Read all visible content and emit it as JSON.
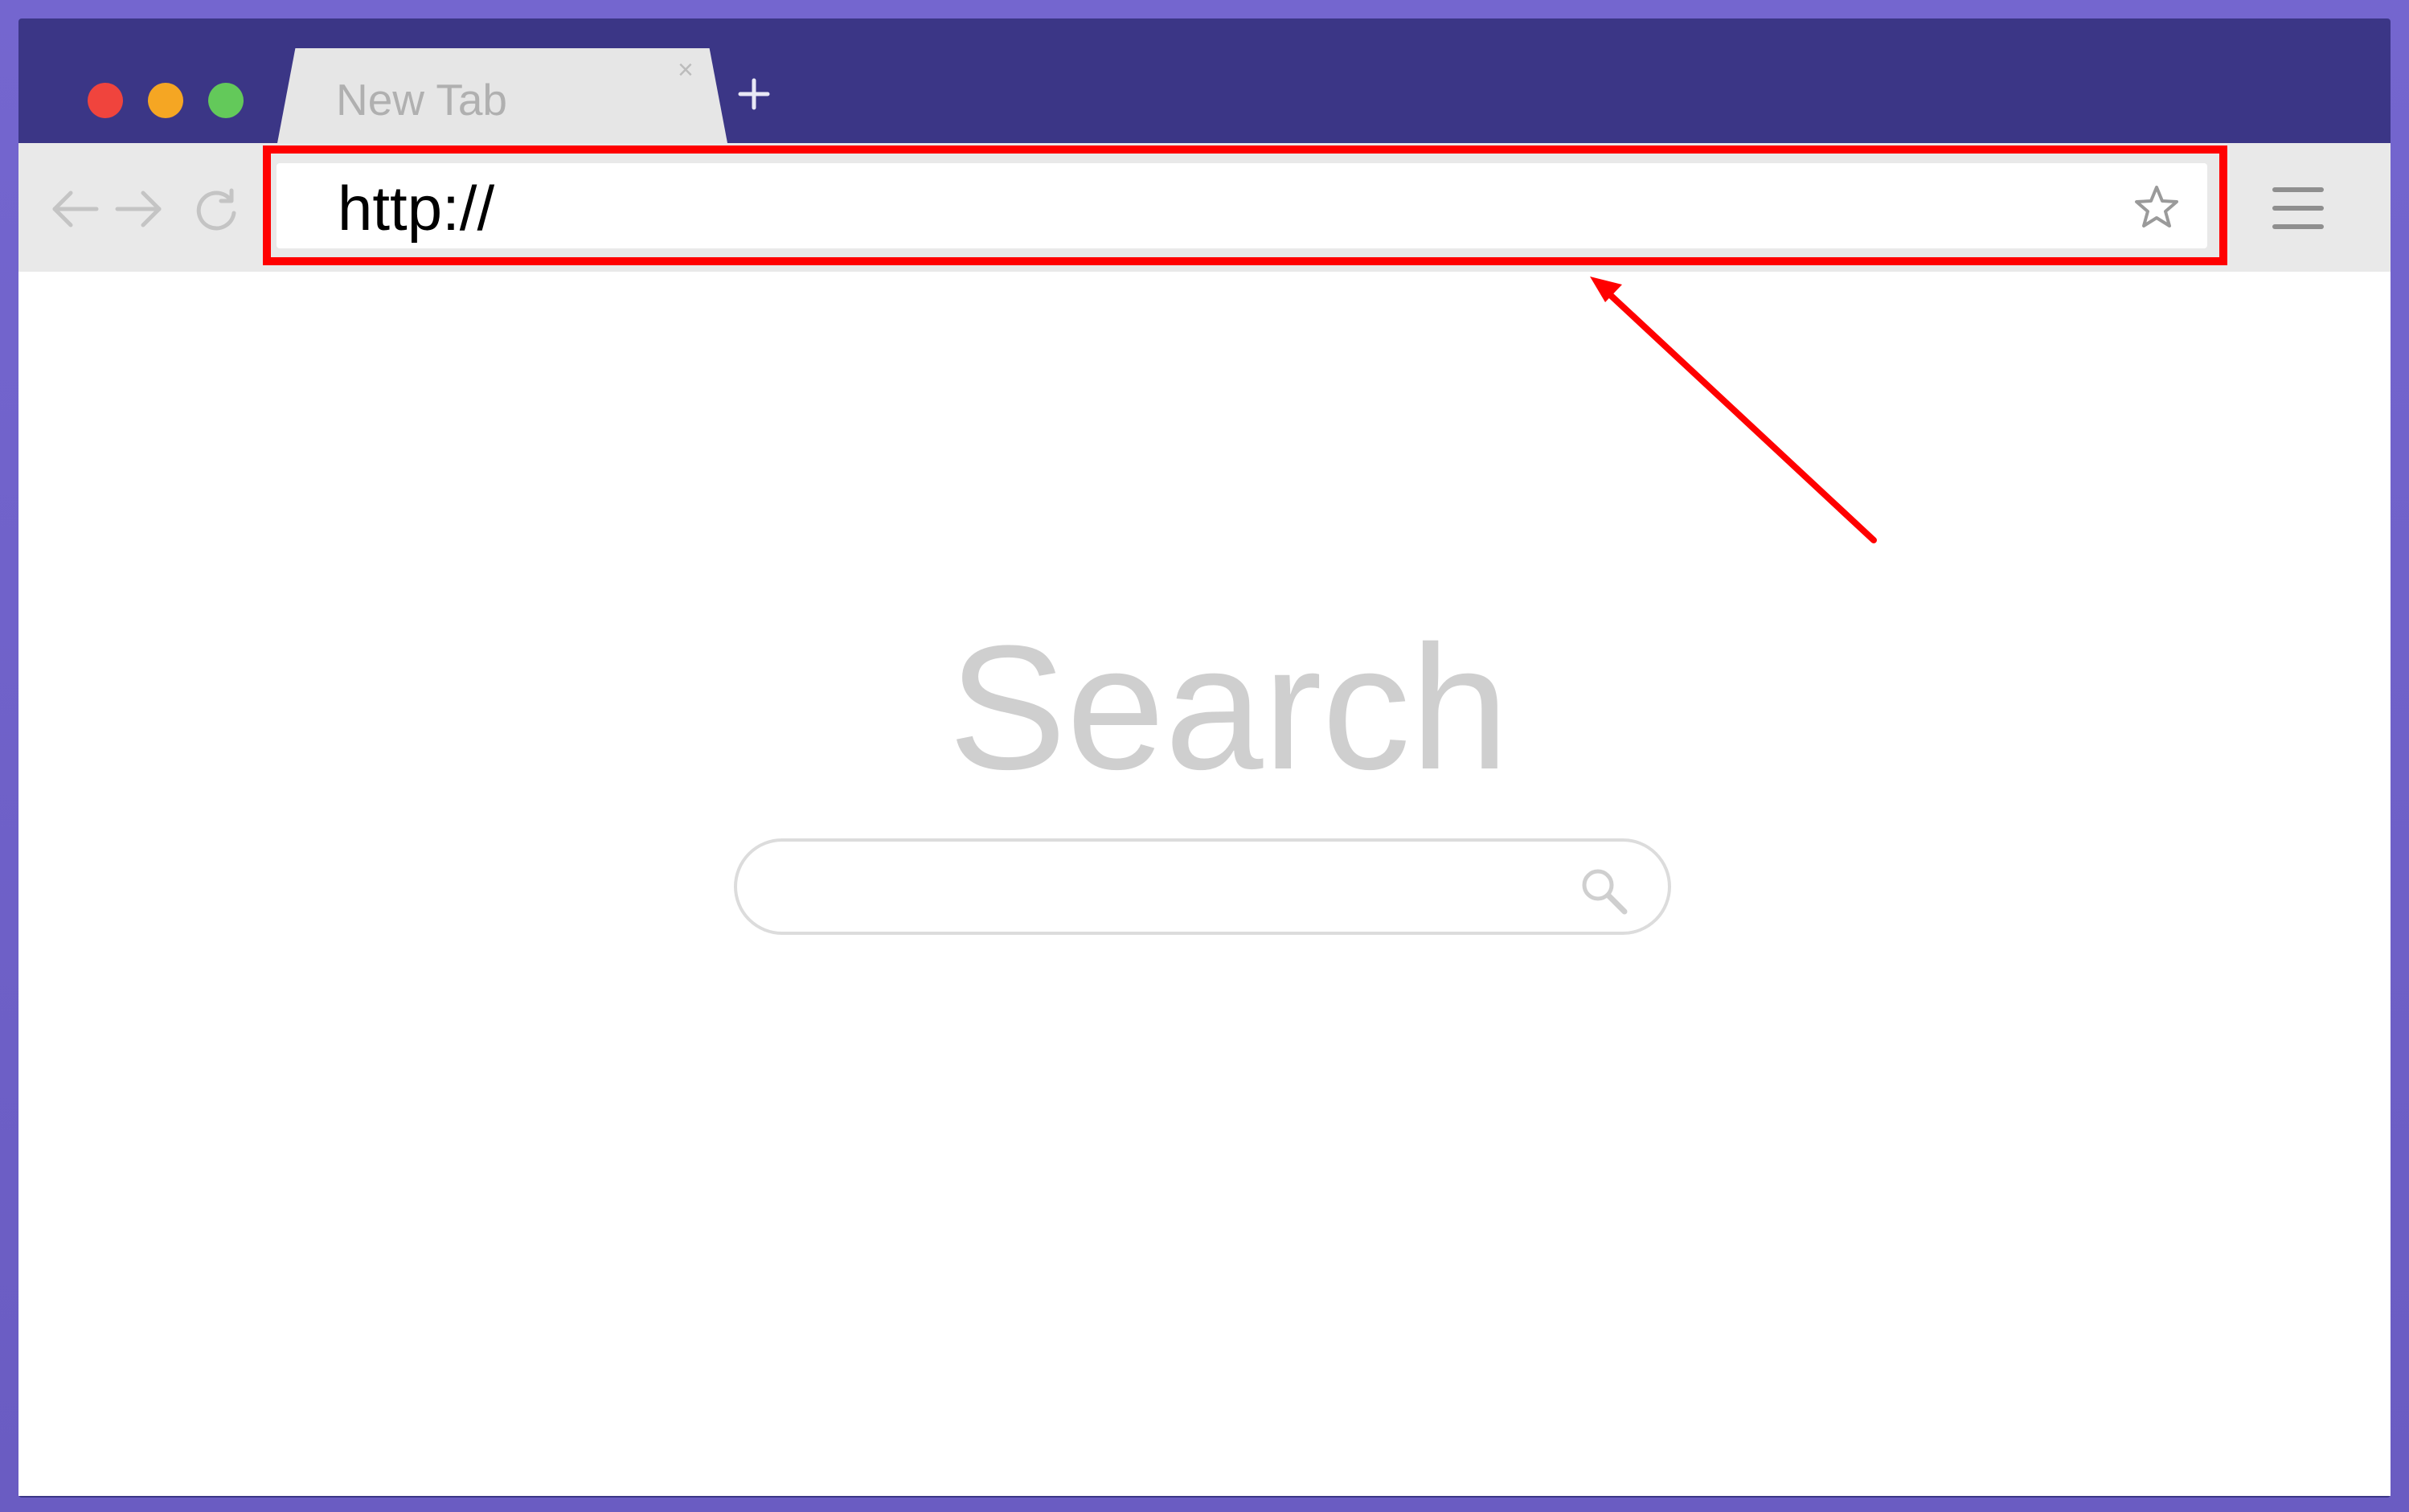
{
  "browser": {
    "tab": {
      "title": "New Tab",
      "close_glyph": "×"
    },
    "new_tab_icon": "plus-icon",
    "address_bar": {
      "value": "http://"
    },
    "icons": [
      "back-arrow-icon",
      "forward-arrow-icon",
      "reload-icon",
      "star-icon",
      "menu-icon"
    ]
  },
  "page": {
    "search_title": "Search",
    "search_icon": "magnifier-icon"
  },
  "colors": {
    "frame": "#6f63c6",
    "title_bar": "#3b3686",
    "highlight": "#ff0000"
  }
}
